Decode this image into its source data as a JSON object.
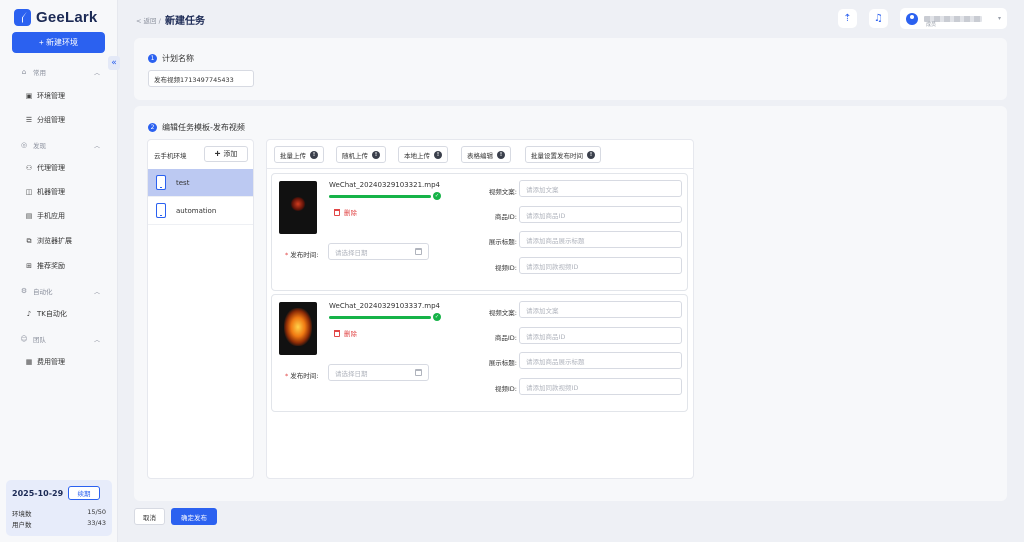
{
  "app": {
    "name": "GeeLark",
    "new_env_label": "+ 新建环境",
    "collapse_icon": "«"
  },
  "nav": {
    "groups": [
      {
        "label": "常用",
        "icon": "home-icon",
        "items": [
          "环境管理",
          "分组管理"
        ]
      },
      {
        "label": "发现",
        "icon": "compass-icon",
        "items": [
          "代理管理",
          "机器管理",
          "手机应用",
          "浏览器扩展",
          "推荐奖励"
        ]
      },
      {
        "label": "自动化",
        "icon": "automation-icon",
        "items": [
          "TK自动化"
        ]
      },
      {
        "label": "团队",
        "icon": "team-icon",
        "items": [
          "费用管理"
        ]
      }
    ]
  },
  "account": {
    "date": "2025-10-29",
    "renew_label": "续期",
    "env_count_label": "环境数",
    "env_count_value": "15/50",
    "user_count_label": "用户数",
    "user_count_value": "33/43"
  },
  "header": {
    "back_label": "< 返回 /",
    "title": "新建任务",
    "user_role": "成员"
  },
  "step1": {
    "num": "1",
    "title": "计划名称",
    "plan_name": "发布视频1713497745433"
  },
  "step2": {
    "num": "2",
    "title": "编辑任务模板-发布视频",
    "env_header": "云手机环境",
    "add_label": "添加",
    "envs": [
      "test",
      "automation"
    ],
    "toolbar": [
      "批量上传",
      "随机上传",
      "本地上传",
      "表格编辑",
      "批量设置发布时间"
    ]
  },
  "videos": [
    {
      "file_name": "WeChat_20240329103321.mp4",
      "progress": 1.0,
      "delete_label": "删除",
      "publish_time_label": "发布时间:",
      "date_placeholder": "请选择日期",
      "fields": [
        {
          "label": "视频文案:",
          "placeholder": "请添加文案"
        },
        {
          "label": "商品ID:",
          "placeholder": "请添加商品ID"
        },
        {
          "label": "展示标题:",
          "placeholder": "请添加商品展示标题"
        },
        {
          "label": "视频ID:",
          "placeholder": "请添加同款视频ID"
        }
      ]
    },
    {
      "file_name": "WeChat_20240329103337.mp4",
      "progress": 1.0,
      "delete_label": "删除",
      "publish_time_label": "发布时间:",
      "date_placeholder": "请选择日期",
      "fields": [
        {
          "label": "视频文案:",
          "placeholder": "请添加文案"
        },
        {
          "label": "商品ID:",
          "placeholder": "请添加商品ID"
        },
        {
          "label": "展示标题:",
          "placeholder": "请添加商品展示标题"
        },
        {
          "label": "视频ID:",
          "placeholder": "请添加同款视频ID"
        }
      ]
    }
  ],
  "footer": {
    "cancel_label": "取消",
    "confirm_label": "确定发布"
  },
  "colors": {
    "accent": "#2b61f0",
    "success": "#16b348",
    "danger": "#e14646",
    "active_row": "#bcc9f2"
  }
}
